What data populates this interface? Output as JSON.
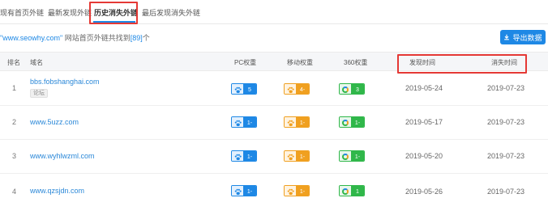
{
  "tabs": [
    {
      "label": "现有首页外链"
    },
    {
      "label": "最新发现外链"
    },
    {
      "label": "历史消失外链"
    },
    {
      "label": "最后发现消失外链"
    }
  ],
  "summary": {
    "domain": "\"www.seowhy.com\"",
    "text": "网站首页外链共找到",
    "count": "[89]",
    "suffix": "个"
  },
  "export_label": "导出数据",
  "headers": {
    "rank": "排名",
    "domain": "域名",
    "pc": "PC权重",
    "mobile": "移动权重",
    "w360": "360权重",
    "found": "发现时间",
    "lost": "消失时间"
  },
  "rows": [
    {
      "rank": "1",
      "domain": "bbs.fobshanghai.com",
      "tag": "论坛",
      "pc": "5",
      "mobile": "4-",
      "w360": "3",
      "found": "2019-05-24",
      "lost": "2019-07-23"
    },
    {
      "rank": "2",
      "domain": "www.5uzz.com",
      "tag": "",
      "pc": "1-",
      "mobile": "1-",
      "w360": "1-",
      "found": "2019-05-17",
      "lost": "2019-07-23"
    },
    {
      "rank": "3",
      "domain": "www.wyhlwzml.com",
      "tag": "",
      "pc": "1-",
      "mobile": "1-",
      "w360": "1-",
      "found": "2019-05-20",
      "lost": "2019-07-23"
    },
    {
      "rank": "4",
      "domain": "www.qzsjdn.com",
      "tag": "",
      "pc": "1-",
      "mobile": "1-",
      "w360": "1",
      "found": "2019-05-26",
      "lost": "2019-07-23"
    }
  ],
  "colors": {
    "accent": "#1e88e5",
    "pc_badge": "#1e88e5",
    "mobile_badge": "#f0a020",
    "w360_badge": "#30b74a",
    "highlight": "#e53935"
  },
  "icons": {
    "export": "download-icon",
    "pc": "paw-icon",
    "mobile": "paw-icon",
    "w360": "360-ring-icon"
  }
}
